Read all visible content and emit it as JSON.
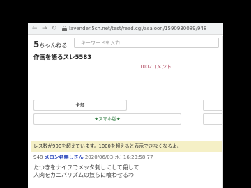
{
  "browser": {
    "back_icon": "arrow-left-icon",
    "forward_icon": "arrow-right-icon",
    "reload_icon": "reload-icon",
    "lock_icon": "lock-icon",
    "url": "lavender.5ch.net/test/read.cgi/asaloon/1590930089/948"
  },
  "site": {
    "brand_big": "5",
    "brand_small": "ちゃんねる",
    "search_placeholder": "キーワードを入力"
  },
  "thread": {
    "title": "作画を語るスレ5583",
    "comment_count": "1002コメント",
    "all_label": "全部",
    "smartphone_label": "★スマホ版★",
    "notice": "レス数が900を超えています。1000を超えると表示できなくなるよ。"
  },
  "post": {
    "number": "948",
    "author": "メロン名無しさん",
    "date": "2020/06/03(水) 16:23:58.77",
    "lines": [
      "たつきをナイフでメッタ刺しにして殺して",
      "人肉をカニバリズムの奴らに喰わせるわ"
    ]
  },
  "colors": {
    "author": "#2340b8",
    "comment_count": "#b0475f",
    "notice_bg": "#f5f0c6"
  }
}
